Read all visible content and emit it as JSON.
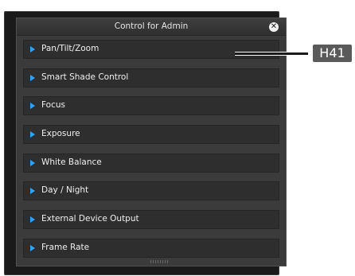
{
  "dialog": {
    "title": "Control for Admin",
    "close_symbol": "✕",
    "close_icon": "close-icon"
  },
  "menu": {
    "arrow_icon": "triangle-right-icon",
    "arrow_color": "#2fa4ff",
    "items": [
      {
        "label": "Pan/Tilt/Zoom"
      },
      {
        "label": "Smart Shade Control"
      },
      {
        "label": "Focus"
      },
      {
        "label": "Exposure"
      },
      {
        "label": "White Balance"
      },
      {
        "label": "Day / Night"
      },
      {
        "label": "External Device Output"
      },
      {
        "label": "Frame Rate"
      }
    ]
  },
  "callout": {
    "tag": "H41"
  }
}
